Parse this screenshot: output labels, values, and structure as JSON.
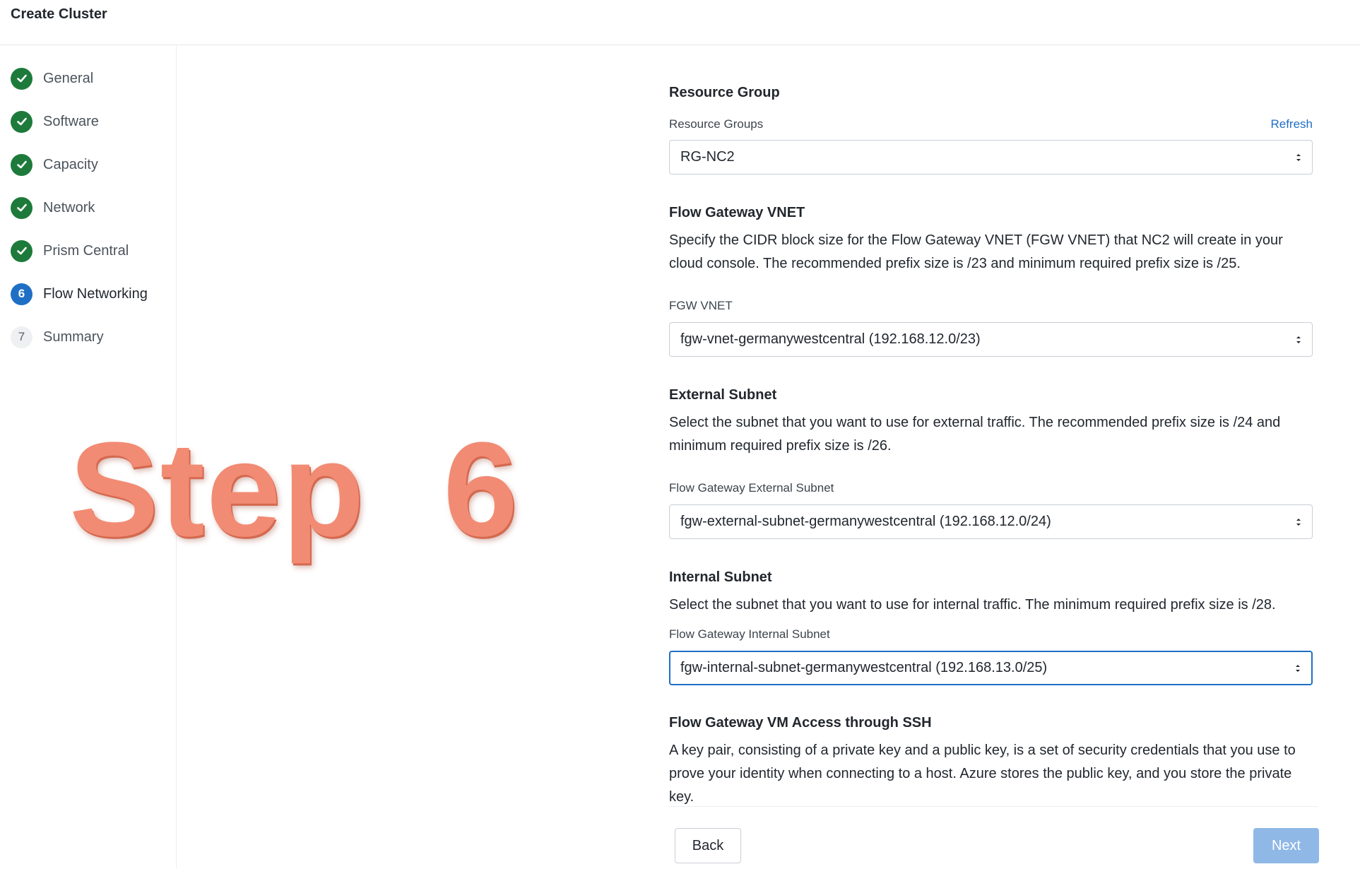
{
  "header": {
    "title": "Create Cluster"
  },
  "steps": [
    {
      "label": "General",
      "status": "done"
    },
    {
      "label": "Software",
      "status": "done"
    },
    {
      "label": "Capacity",
      "status": "done"
    },
    {
      "label": "Network",
      "status": "done"
    },
    {
      "label": "Prism Central",
      "status": "done"
    },
    {
      "label": "Flow Networking",
      "status": "current",
      "number": "6"
    },
    {
      "label": "Summary",
      "status": "todo",
      "number": "7"
    }
  ],
  "watermark": {
    "text": "Step  6"
  },
  "resource_group": {
    "title": "Resource Group",
    "field_label": "Resource Groups",
    "refresh_label": "Refresh",
    "value": "RG-NC2"
  },
  "fgw_vnet": {
    "title": "Flow Gateway VNET",
    "description": "Specify the CIDR block size for the Flow Gateway VNET (FGW VNET) that NC2 will create in your cloud console. The recommended prefix size is /23 and minimum required prefix size is /25.",
    "field_label": "FGW VNET",
    "value": "fgw-vnet-germanywestcentral (192.168.12.0/23)"
  },
  "external_subnet": {
    "title": "External Subnet",
    "description": "Select the subnet that you want to use for external traffic. The recommended prefix size is /24 and minimum required prefix size is /26.",
    "field_label": "Flow Gateway External Subnet",
    "value": "fgw-external-subnet-germanywestcentral (192.168.12.0/24)"
  },
  "internal_subnet": {
    "title": "Internal Subnet",
    "description": "Select the subnet that you want to use for internal traffic. The minimum required prefix size is /28.",
    "field_label": "Flow Gateway Internal Subnet",
    "value": "fgw-internal-subnet-germanywestcentral (192.168.13.0/25)"
  },
  "ssh_access": {
    "title": "Flow Gateway VM Access through SSH",
    "description": "A key pair, consisting of a private key and a public key, is a set of security credentials that you use to prove your identity when connecting to a host. Azure stores the public key, and you store the private key."
  },
  "footer": {
    "back_label": "Back",
    "next_label": "Next"
  },
  "colors": {
    "done": "#1d7a3a",
    "current": "#1f6fc5",
    "watermark": "#f28b74",
    "next_disabled": "#8fb8e6"
  },
  "icons": {
    "done": "check-icon",
    "select": "select-arrows-icon"
  }
}
